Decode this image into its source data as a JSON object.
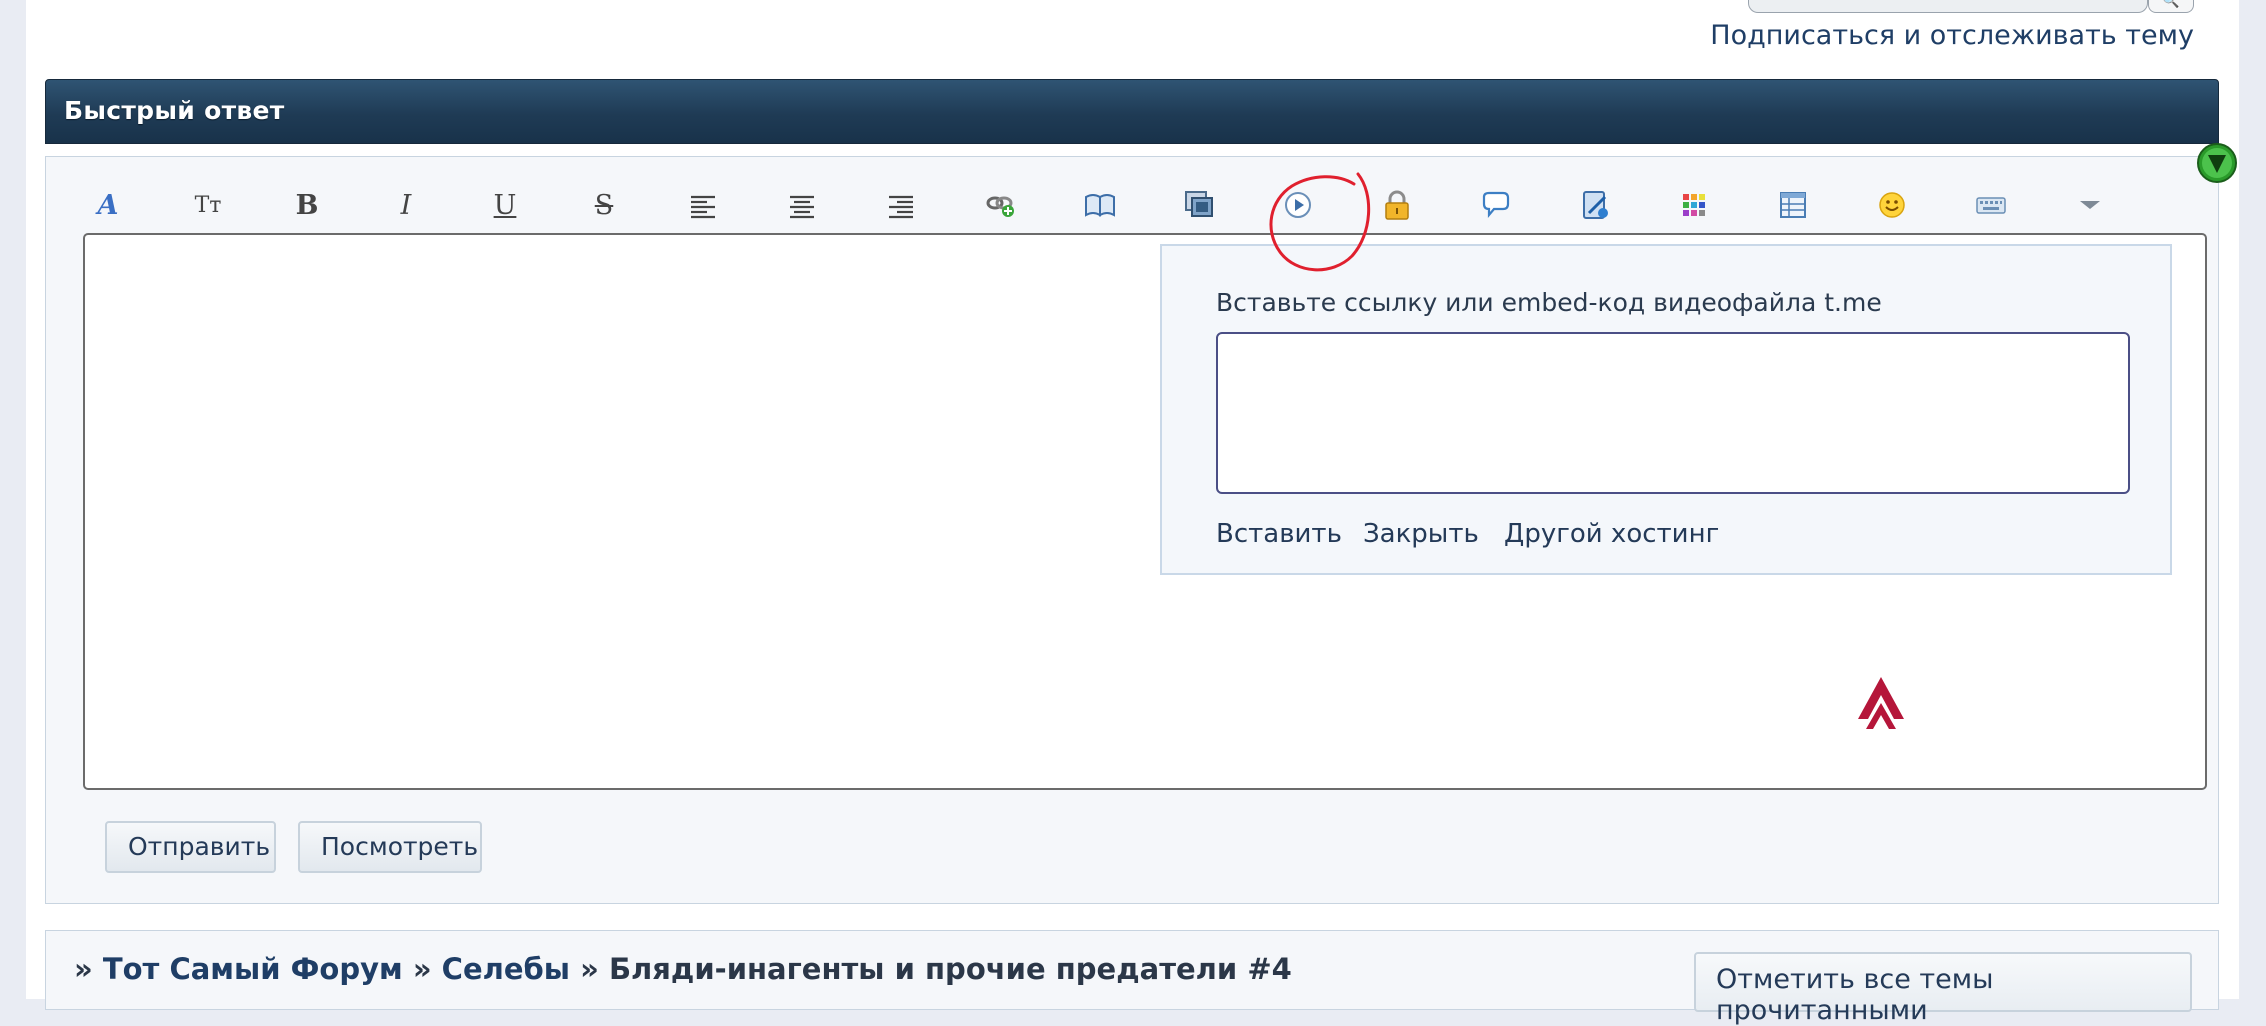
{
  "top": {
    "search_button_glyph": "🔍",
    "subscribe_link": "Подписаться и отслеживать тему"
  },
  "quick_reply": {
    "title": "Быстрый ответ"
  },
  "toolbar": {
    "items": [
      {
        "name": "font-icon",
        "glyph": "A"
      },
      {
        "name": "font-size-icon",
        "glyph": "Tт"
      },
      {
        "name": "bold-icon",
        "glyph": "B"
      },
      {
        "name": "italic-icon",
        "glyph": "I"
      },
      {
        "name": "underline-icon",
        "glyph": "U"
      },
      {
        "name": "strikethrough-icon",
        "glyph": "S"
      },
      {
        "name": "align-left-icon"
      },
      {
        "name": "align-center-icon"
      },
      {
        "name": "align-right-icon"
      },
      {
        "name": "link-icon"
      },
      {
        "name": "book-icon"
      },
      {
        "name": "gallery-icon"
      },
      {
        "name": "video-icon"
      },
      {
        "name": "lock-icon"
      },
      {
        "name": "quote-bubble-icon"
      },
      {
        "name": "code-icon"
      },
      {
        "name": "color-palette-icon"
      },
      {
        "name": "table-icon"
      },
      {
        "name": "smiley-icon"
      },
      {
        "name": "keyboard-icon"
      },
      {
        "name": "more-dropdown-icon"
      }
    ]
  },
  "video_popup": {
    "label": "Вставьте ссылку или embed-код видеофайла t.me",
    "input_value": "",
    "insert": "Вставить",
    "close": "Закрыть",
    "other_hosting": "Другой хостинг"
  },
  "actions": {
    "send": "Отправить",
    "preview": "Посмотреть"
  },
  "breadcrumb": {
    "sep": "»",
    "forum": "Тот Самый Форум",
    "section": "Селебы",
    "topic": "Бляди-инагенты и прочие предатели #4"
  },
  "mark_all_read": "Отметить все темы прочитанными",
  "colors": {
    "header_bg": "#1f3b55",
    "link": "#1f3e66",
    "annotation": "#e0202e"
  }
}
